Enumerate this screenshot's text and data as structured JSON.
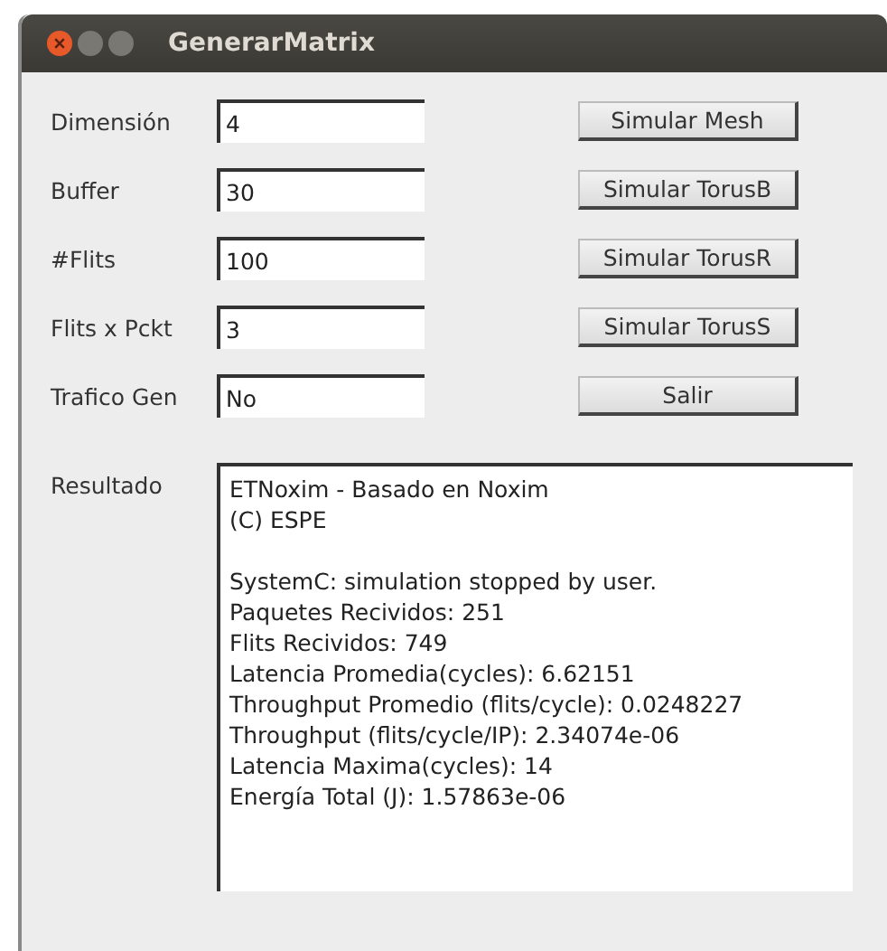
{
  "window": {
    "title": "GenerarMatrix"
  },
  "fields": [
    {
      "label": "Dimensión",
      "value": "4"
    },
    {
      "label": "Buffer",
      "value": "30"
    },
    {
      "label": "#Flits",
      "value": "100"
    },
    {
      "label": "Flits x Pckt",
      "value": "3"
    },
    {
      "label": "Trafico Gen",
      "value": "No"
    }
  ],
  "buttons": [
    "Simular Mesh",
    "Simular TorusB",
    "Simular TorusR",
    "Simular TorusS",
    "Salir"
  ],
  "result": {
    "label": "Resultado",
    "blocks": [
      [
        "ETNoxim - Basado en Noxim",
        "(C) ESPE"
      ],
      [
        "SystemC: simulation stopped by user.",
        "Paquetes Recividos: 251",
        "Flits Recividos: 749",
        "Latencia Promedia(cycles): 6.62151",
        "Throughput Promedio (flits/cycle): 0.0248227",
        "Throughput (flits/cycle/IP): 2.34074e-06",
        "Latencia Maxima(cycles): 14",
        "Energía Total (J): 1.57863e-06"
      ]
    ]
  }
}
